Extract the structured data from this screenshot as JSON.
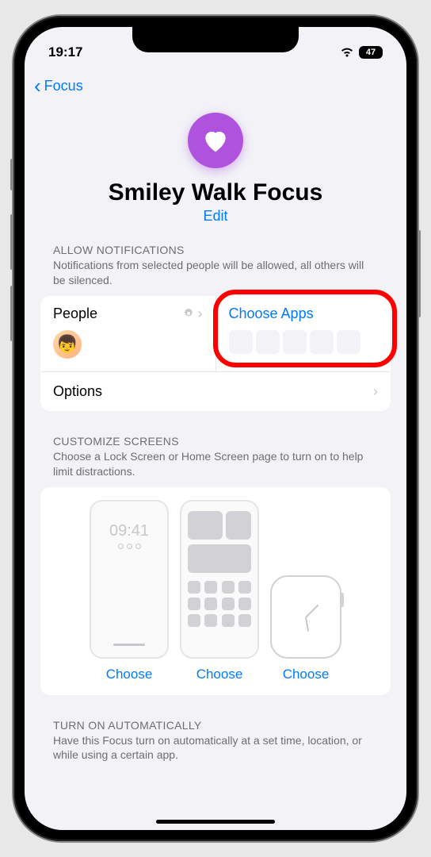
{
  "status": {
    "time": "19:17",
    "battery": "47"
  },
  "nav": {
    "back_label": "Focus"
  },
  "header": {
    "title": "Smiley Walk Focus",
    "edit": "Edit"
  },
  "notifications": {
    "section_title": "ALLOW NOTIFICATIONS",
    "section_desc": "Notifications from selected people will be allowed, all others will be silenced.",
    "people_label": "People",
    "apps_label": "Choose Apps",
    "options_label": "Options"
  },
  "screens": {
    "section_title": "CUSTOMIZE SCREENS",
    "section_desc": "Choose a Lock Screen or Home Screen page to turn on to help limit distractions.",
    "lock_time": "09:41",
    "choose": "Choose"
  },
  "automation": {
    "section_title": "TURN ON AUTOMATICALLY",
    "section_desc": "Have this Focus turn on automatically at a set time, location, or while using a certain app."
  }
}
